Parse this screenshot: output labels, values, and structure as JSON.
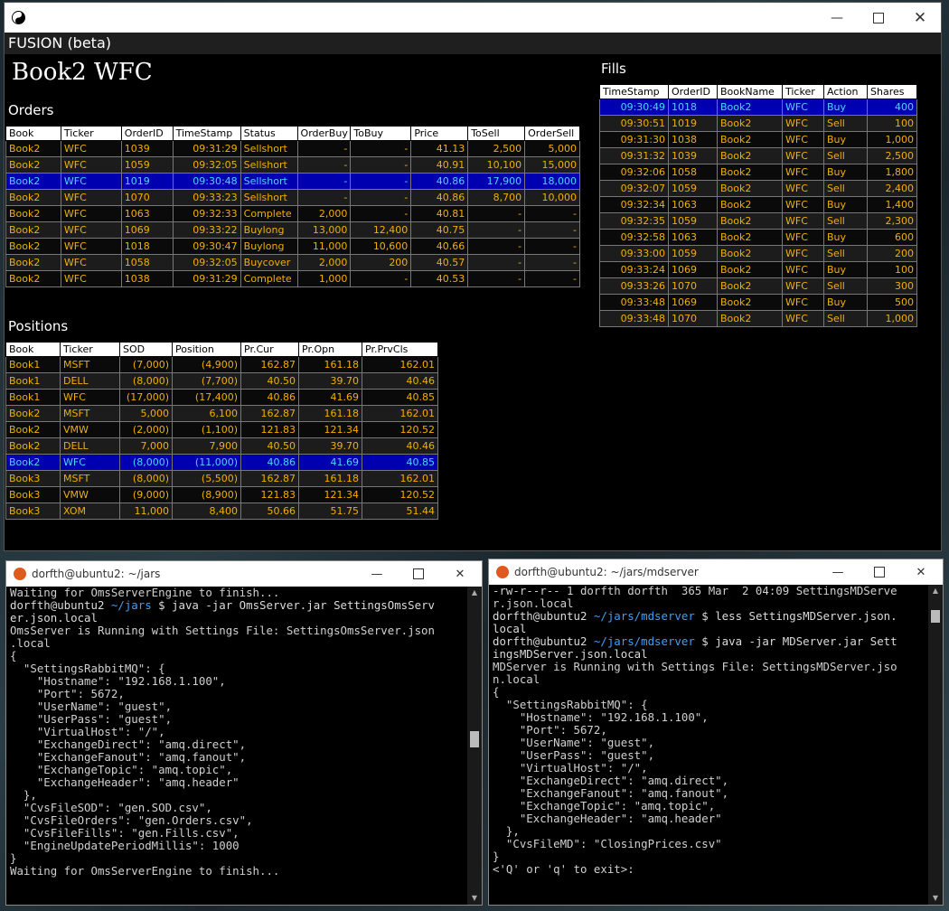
{
  "main_window": {
    "app_header": "FUSION (beta)",
    "book_title": "Book2  WFC",
    "orders_label": "Orders",
    "fills_label": "Fills",
    "positions_label": "Positions"
  },
  "orders": {
    "headers": [
      "Book",
      "Ticker",
      "OrderID",
      "TimeStamp",
      "Status",
      "OrderBuy",
      "ToBuy",
      "Price",
      "ToSell",
      "OrderSell"
    ],
    "rows": [
      [
        "Book2",
        "WFC",
        "1039",
        "09:31:29",
        "Sellshort",
        "-",
        "-",
        "41.13",
        "2,500",
        "5,000"
      ],
      [
        "Book2",
        "WFC",
        "1059",
        "09:32:05",
        "Sellshort",
        "-",
        "-",
        "40.91",
        "10,100",
        "15,000"
      ],
      [
        "Book2",
        "WFC",
        "1019",
        "09:30:48",
        "Sellshort",
        "-",
        "-",
        "40.86",
        "17,900",
        "18,000"
      ],
      [
        "Book2",
        "WFC",
        "1070",
        "09:33:23",
        "Sellshort",
        "-",
        "-",
        "40.86",
        "8,700",
        "10,000"
      ],
      [
        "Book2",
        "WFC",
        "1063",
        "09:32:33",
        "Complete",
        "2,000",
        "-",
        "40.81",
        "-",
        "-"
      ],
      [
        "Book2",
        "WFC",
        "1069",
        "09:33:22",
        "Buylong",
        "13,000",
        "12,400",
        "40.75",
        "-",
        "-"
      ],
      [
        "Book2",
        "WFC",
        "1018",
        "09:30:47",
        "Buylong",
        "11,000",
        "10,600",
        "40.66",
        "-",
        "-"
      ],
      [
        "Book2",
        "WFC",
        "1058",
        "09:32:05",
        "Buycover",
        "2,000",
        "200",
        "40.57",
        "-",
        "-"
      ],
      [
        "Book2",
        "WFC",
        "1038",
        "09:31:29",
        "Complete",
        "1,000",
        "-",
        "40.53",
        "-",
        "-"
      ]
    ],
    "selected_row": 2
  },
  "fills": {
    "headers": [
      "TimeStamp",
      "OrderID",
      "BookName",
      "Ticker",
      "Action",
      "Shares"
    ],
    "rows": [
      [
        "09:30:49",
        "1018",
        "Book2",
        "WFC",
        "Buy",
        "400"
      ],
      [
        "09:30:51",
        "1019",
        "Book2",
        "WFC",
        "Sell",
        "100"
      ],
      [
        "09:31:30",
        "1038",
        "Book2",
        "WFC",
        "Buy",
        "1,000"
      ],
      [
        "09:31:32",
        "1039",
        "Book2",
        "WFC",
        "Sell",
        "2,500"
      ],
      [
        "09:32:06",
        "1058",
        "Book2",
        "WFC",
        "Buy",
        "1,800"
      ],
      [
        "09:32:07",
        "1059",
        "Book2",
        "WFC",
        "Sell",
        "2,400"
      ],
      [
        "09:32:34",
        "1063",
        "Book2",
        "WFC",
        "Buy",
        "1,400"
      ],
      [
        "09:32:35",
        "1059",
        "Book2",
        "WFC",
        "Sell",
        "2,300"
      ],
      [
        "09:32:58",
        "1063",
        "Book2",
        "WFC",
        "Buy",
        "600"
      ],
      [
        "09:33:00",
        "1059",
        "Book2",
        "WFC",
        "Sell",
        "200"
      ],
      [
        "09:33:24",
        "1069",
        "Book2",
        "WFC",
        "Buy",
        "100"
      ],
      [
        "09:33:26",
        "1070",
        "Book2",
        "WFC",
        "Sell",
        "300"
      ],
      [
        "09:33:48",
        "1069",
        "Book2",
        "WFC",
        "Buy",
        "500"
      ],
      [
        "09:33:48",
        "1070",
        "Book2",
        "WFC",
        "Sell",
        "1,000"
      ]
    ],
    "selected_row": 0
  },
  "positions": {
    "headers": [
      "Book",
      "Ticker",
      "SOD",
      "Position",
      "Pr.Cur",
      "Pr.Opn",
      "Pr.PrvCls"
    ],
    "rows": [
      [
        "Book1",
        "MSFT",
        "(7,000)",
        "(4,900)",
        "162.87",
        "161.18",
        "162.01"
      ],
      [
        "Book1",
        "DELL",
        "(8,000)",
        "(7,700)",
        "40.50",
        "39.70",
        "40.46"
      ],
      [
        "Book1",
        "WFC",
        "(17,000)",
        "(17,400)",
        "40.86",
        "41.69",
        "40.85"
      ],
      [
        "Book2",
        "MSFT",
        "5,000",
        "6,100",
        "162.87",
        "161.18",
        "162.01"
      ],
      [
        "Book2",
        "VMW",
        "(2,000)",
        "(1,100)",
        "121.83",
        "121.34",
        "120.52"
      ],
      [
        "Book2",
        "DELL",
        "7,000",
        "7,900",
        "40.50",
        "39.70",
        "40.46"
      ],
      [
        "Book2",
        "WFC",
        "(8,000)",
        "(11,000)",
        "40.86",
        "41.69",
        "40.85"
      ],
      [
        "Book3",
        "MSFT",
        "(8,000)",
        "(5,500)",
        "162.87",
        "161.18",
        "162.01"
      ],
      [
        "Book3",
        "VMW",
        "(9,000)",
        "(8,900)",
        "121.83",
        "121.34",
        "120.52"
      ],
      [
        "Book3",
        "XOM",
        "11,000",
        "8,400",
        "50.66",
        "51.75",
        "51.44"
      ]
    ],
    "selected_row": 6
  },
  "terminal_left": {
    "title": "dorfth@ubuntu2: ~/jars",
    "lines": [
      [
        {
          "t": "Waiting for OmsServerEngine to finish...",
          "c": ""
        }
      ],
      [
        {
          "t": "dorfth@ubuntu2 ",
          "c": "prompt"
        },
        {
          "t": "~/jars",
          "c": "path"
        },
        {
          "t": " $ java -jar OmsServer.jar SettingsOmsServ",
          "c": "prompt"
        }
      ],
      [
        {
          "t": "er.json.local",
          "c": "prompt"
        }
      ],
      [
        {
          "t": "OmsServer is Running with Settings File: SettingsOmsServer.json",
          "c": ""
        }
      ],
      [
        {
          "t": ".local",
          "c": ""
        }
      ],
      [
        {
          "t": "{",
          "c": ""
        }
      ],
      [
        {
          "t": "  \"SettingsRabbitMQ\": {",
          "c": ""
        }
      ],
      [
        {
          "t": "    \"Hostname\": \"192.168.1.100\",",
          "c": ""
        }
      ],
      [
        {
          "t": "    \"Port\": 5672,",
          "c": ""
        }
      ],
      [
        {
          "t": "    \"UserName\": \"guest\",",
          "c": ""
        }
      ],
      [
        {
          "t": "    \"UserPass\": \"guest\",",
          "c": ""
        }
      ],
      [
        {
          "t": "    \"VirtualHost\": \"/\",",
          "c": ""
        }
      ],
      [
        {
          "t": "    \"ExchangeDirect\": \"amq.direct\",",
          "c": ""
        }
      ],
      [
        {
          "t": "    \"ExchangeFanout\": \"amq.fanout\",",
          "c": ""
        }
      ],
      [
        {
          "t": "    \"ExchangeTopic\": \"amq.topic\",",
          "c": ""
        }
      ],
      [
        {
          "t": "    \"ExchangeHeader\": \"amq.header\"",
          "c": ""
        }
      ],
      [
        {
          "t": "  },",
          "c": ""
        }
      ],
      [
        {
          "t": "  \"CvsFileSOD\": \"gen.SOD.csv\",",
          "c": ""
        }
      ],
      [
        {
          "t": "  \"CvsFileOrders\": \"gen.Orders.csv\",",
          "c": ""
        }
      ],
      [
        {
          "t": "  \"CvsFileFills\": \"gen.Fills.csv\",",
          "c": ""
        }
      ],
      [
        {
          "t": "  \"EngineUpdatePeriodMillis\": 1000",
          "c": ""
        }
      ],
      [
        {
          "t": "}",
          "c": ""
        }
      ],
      [
        {
          "t": "Waiting for OmsServerEngine to finish...",
          "c": ""
        }
      ]
    ]
  },
  "terminal_right": {
    "title": "dorfth@ubuntu2: ~/jars/mdserver",
    "lines": [
      [
        {
          "t": "-rw-r--r-- 1 dorfth dorfth  365 Mar  2 04:09 SettingsMDServe",
          "c": ""
        }
      ],
      [
        {
          "t": "r.json.local",
          "c": ""
        }
      ],
      [
        {
          "t": "dorfth@ubuntu2 ",
          "c": "prompt"
        },
        {
          "t": "~/jars/mdserver",
          "c": "path"
        },
        {
          "t": " $ less SettingsMDServer.json.",
          "c": "prompt"
        }
      ],
      [
        {
          "t": "local",
          "c": "prompt"
        }
      ],
      [
        {
          "t": "dorfth@ubuntu2 ",
          "c": "prompt"
        },
        {
          "t": "~/jars/mdserver",
          "c": "path"
        },
        {
          "t": " $ java -jar MDServer.jar Sett",
          "c": "prompt"
        }
      ],
      [
        {
          "t": "ingsMDServer.json.local",
          "c": "prompt"
        }
      ],
      [
        {
          "t": "MDServer is Running with Settings File: SettingsMDServer.jso",
          "c": ""
        }
      ],
      [
        {
          "t": "n.local",
          "c": ""
        }
      ],
      [
        {
          "t": "{",
          "c": ""
        }
      ],
      [
        {
          "t": "  \"SettingsRabbitMQ\": {",
          "c": ""
        }
      ],
      [
        {
          "t": "    \"Hostname\": \"192.168.1.100\",",
          "c": ""
        }
      ],
      [
        {
          "t": "    \"Port\": 5672,",
          "c": ""
        }
      ],
      [
        {
          "t": "    \"UserName\": \"guest\",",
          "c": ""
        }
      ],
      [
        {
          "t": "    \"UserPass\": \"guest\",",
          "c": ""
        }
      ],
      [
        {
          "t": "    \"VirtualHost\": \"/\",",
          "c": ""
        }
      ],
      [
        {
          "t": "    \"ExchangeDirect\": \"amq.direct\",",
          "c": ""
        }
      ],
      [
        {
          "t": "    \"ExchangeFanout\": \"amq.fanout\",",
          "c": ""
        }
      ],
      [
        {
          "t": "    \"ExchangeTopic\": \"amq.topic\",",
          "c": ""
        }
      ],
      [
        {
          "t": "    \"ExchangeHeader\": \"amq.header\"",
          "c": ""
        }
      ],
      [
        {
          "t": "  },",
          "c": ""
        }
      ],
      [
        {
          "t": "  \"CvsFileMD\": \"ClosingPrices.csv\"",
          "c": ""
        }
      ],
      [
        {
          "t": "}",
          "c": ""
        }
      ],
      [
        {
          "t": "<'Q' or 'q' to exit>:",
          "c": ""
        }
      ]
    ]
  },
  "icons": {
    "minimize": "minimize-icon",
    "maximize": "maximize-icon",
    "close": "close-icon",
    "app": "yin-yang-icon",
    "terminal": "ubuntu-icon"
  }
}
